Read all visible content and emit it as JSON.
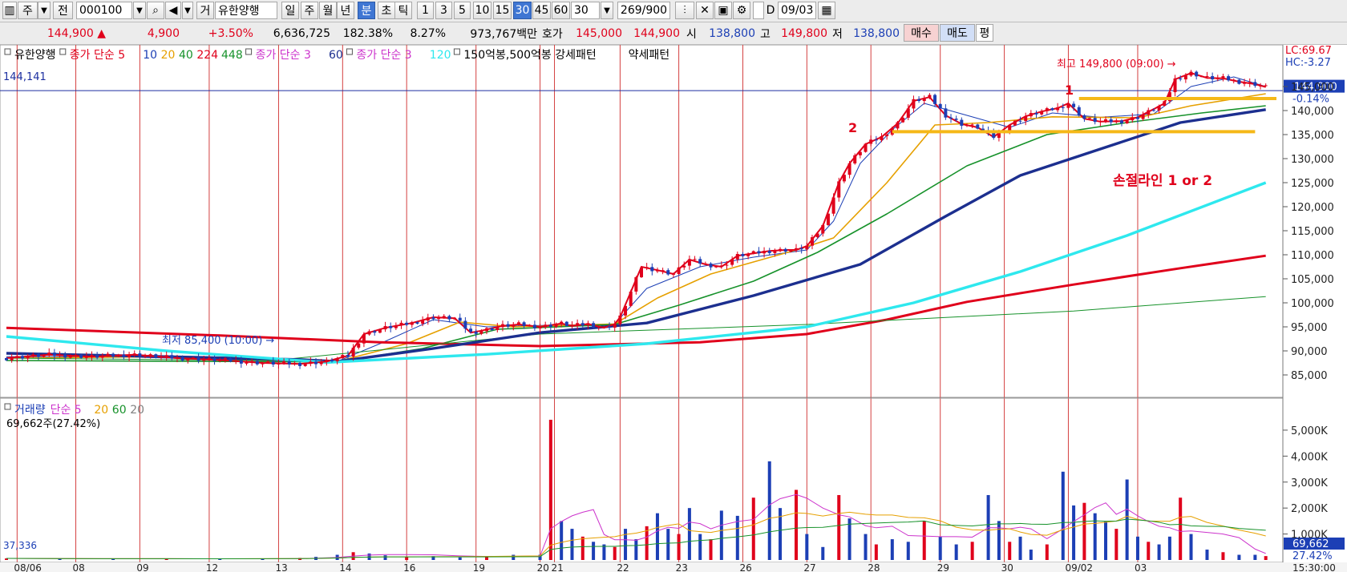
{
  "toolbar": {
    "mode": "주",
    "prev": "전",
    "code": "000100",
    "trade": "거",
    "stock_name": "유한양행",
    "periods": [
      "일",
      "주",
      "월",
      "년",
      "분",
      "초",
      "틱"
    ],
    "active_period": "분",
    "intervals": [
      "1",
      "3",
      "5",
      "10",
      "15",
      "30",
      "45",
      "60"
    ],
    "active_interval": "30",
    "interval_value": "30",
    "count": "269",
    "total": "/900",
    "checkbox_label": "D",
    "date": "09/03"
  },
  "quote": {
    "price": "144,900",
    "change": "4,900",
    "change_pct": "+3.50%",
    "volume": "6,636,725",
    "vol_ratio": "182.38%",
    "turnover": "8.27%",
    "amount": "973,767백만",
    "bid_label": "호가",
    "ask": "145,000",
    "bid": "144,900",
    "open_label": "시",
    "open": "138,800",
    "high_label": "고",
    "high": "149,800",
    "low_label": "저",
    "low": "138,800",
    "buy": "매수",
    "sell": "매도",
    "even": "평"
  },
  "legend_price": {
    "name": "유한양행",
    "ma1_label": "종가 단순 5",
    "ma1_periods": [
      {
        "label": "10",
        "color": "#1c3fb5"
      },
      {
        "label": "20",
        "color": "#e6a000"
      },
      {
        "label": "40",
        "color": "#17922b"
      },
      {
        "label": "224",
        "color": "#e0001b"
      },
      {
        "label": "448",
        "color": "#17922b"
      }
    ],
    "ma2_label": "종가 단순 3",
    "ma2_period": "60",
    "ma3_label": "종가 단순 3",
    "ma3_period": "120",
    "pattern": "150억봉,500억봉 강세패턴",
    "pattern2": "약세패턴"
  },
  "legend_volume": {
    "name": "거래량",
    "label": "단순 5",
    "periods": [
      {
        "label": "20",
        "color": "#e6a000"
      },
      {
        "label": "60",
        "color": "#17922b"
      },
      {
        "label": "20",
        "color": "#808080"
      }
    ],
    "value": "69,662주(27.42%)"
  },
  "chart_data": {
    "type": "line",
    "subtype": "candlestick-with-moving-averages",
    "x_tick_labels": [
      "08/06",
      "08",
      "09",
      "12",
      "13",
      "14",
      "16",
      "19",
      "20",
      "21",
      "22",
      "23",
      "26",
      "27",
      "28",
      "29",
      "30",
      "09/02",
      "03"
    ],
    "time_label": "15:30:00",
    "price_axis": {
      "ticks": [
        85000,
        90000,
        95000,
        100000,
        105000,
        110000,
        115000,
        120000,
        125000,
        130000,
        135000,
        140000,
        145000
      ],
      "ylim": [
        82000,
        152000
      ]
    },
    "volume_axis": {
      "ticks": [
        "1,000K",
        "2,000K",
        "3,000K",
        "4,000K",
        "5,000K"
      ],
      "ylim": [
        0,
        5800
      ]
    },
    "top_left_label": "144,141",
    "lc_label": "LC:69.67",
    "hc_label": "HC:-3.27",
    "price_badge": "144,900",
    "price_badge_pct": "-0.14%",
    "volume_badge": "69,662",
    "volume_badge_pct": "27.42%",
    "volume_axis_min_label": "37,336",
    "close_path": [
      [
        0,
        88500
      ],
      [
        8,
        89200
      ],
      [
        16,
        88800
      ],
      [
        24,
        89200
      ],
      [
        32,
        88500
      ],
      [
        40,
        88100
      ],
      [
        48,
        87500
      ],
      [
        55,
        87300
      ],
      [
        60,
        87800
      ],
      [
        64,
        89000
      ],
      [
        67,
        93500
      ],
      [
        71,
        94800
      ],
      [
        76,
        95800
      ],
      [
        80,
        97000
      ],
      [
        84,
        96800
      ],
      [
        87,
        93800
      ],
      [
        89,
        94200
      ],
      [
        93,
        95200
      ],
      [
        96,
        95500
      ],
      [
        100,
        95000
      ],
      [
        104,
        95700
      ],
      [
        106,
        95200
      ],
      [
        109,
        95600
      ],
      [
        112,
        94800
      ],
      [
        114,
        95600
      ],
      [
        115,
        97000
      ],
      [
        119,
        107500
      ],
      [
        122,
        106800
      ],
      [
        125,
        106000
      ],
      [
        128,
        109000
      ],
      [
        131,
        108000
      ],
      [
        134,
        107500
      ],
      [
        137,
        109800
      ],
      [
        140,
        110300
      ],
      [
        143,
        110800
      ],
      [
        146,
        111000
      ],
      [
        148,
        111000
      ],
      [
        150,
        111800
      ],
      [
        153,
        116000
      ],
      [
        156,
        125000
      ],
      [
        158,
        129000
      ],
      [
        161,
        133000
      ],
      [
        164,
        134500
      ],
      [
        167,
        137300
      ],
      [
        170,
        142000
      ],
      [
        173,
        142800
      ],
      [
        176,
        139000
      ],
      [
        179,
        137200
      ],
      [
        182,
        136500
      ],
      [
        185,
        134500
      ],
      [
        188,
        137000
      ],
      [
        191,
        138800
      ],
      [
        194,
        139800
      ],
      [
        197,
        140500
      ],
      [
        199,
        141500
      ],
      [
        202,
        138300
      ],
      [
        205,
        137700
      ],
      [
        209,
        137800
      ],
      [
        212,
        138600
      ],
      [
        215,
        140300
      ],
      [
        217,
        141500
      ],
      [
        219,
        146500
      ],
      [
        222,
        147800
      ],
      [
        225,
        146800
      ],
      [
        228,
        146700
      ],
      [
        231,
        146000
      ],
      [
        234,
        145500
      ],
      [
        236,
        144900
      ]
    ],
    "series": [
      {
        "name": "10",
        "color": "#1c3fb5",
        "width": 1,
        "values": [
          [
            0,
            88800
          ],
          [
            20,
            88800
          ],
          [
            50,
            88000
          ],
          [
            62,
            87800
          ],
          [
            70,
            91500
          ],
          [
            80,
            96500
          ],
          [
            90,
            95000
          ],
          [
            100,
            95300
          ],
          [
            114,
            95600
          ],
          [
            120,
            103000
          ],
          [
            130,
            107500
          ],
          [
            140,
            109500
          ],
          [
            150,
            111000
          ],
          [
            155,
            117000
          ],
          [
            160,
            129000
          ],
          [
            166,
            136000
          ],
          [
            172,
            141500
          ],
          [
            180,
            139000
          ],
          [
            188,
            136500
          ],
          [
            196,
            139500
          ],
          [
            205,
            138600
          ],
          [
            215,
            139300
          ],
          [
            222,
            145000
          ],
          [
            230,
            147000
          ],
          [
            236,
            145000
          ]
        ]
      },
      {
        "name": "20",
        "color": "#e6a000",
        "width": 1.6,
        "values": [
          [
            0,
            88500
          ],
          [
            30,
            88800
          ],
          [
            62,
            87800
          ],
          [
            75,
            91500
          ],
          [
            85,
            96000
          ],
          [
            95,
            95000
          ],
          [
            114,
            95600
          ],
          [
            122,
            101000
          ],
          [
            132,
            106000
          ],
          [
            148,
            111000
          ],
          [
            155,
            113500
          ],
          [
            165,
            125000
          ],
          [
            174,
            137000
          ],
          [
            184,
            137500
          ],
          [
            196,
            138700
          ],
          [
            212,
            138500
          ],
          [
            222,
            141000
          ],
          [
            236,
            143500
          ]
        ]
      },
      {
        "name": "40",
        "color": "#17922b",
        "width": 1.6,
        "values": [
          [
            0,
            88000
          ],
          [
            62,
            87700
          ],
          [
            78,
            90500
          ],
          [
            92,
            94500
          ],
          [
            114,
            95500
          ],
          [
            126,
            99500
          ],
          [
            140,
            104500
          ],
          [
            152,
            110500
          ],
          [
            165,
            118500
          ],
          [
            180,
            128500
          ],
          [
            195,
            135000
          ],
          [
            210,
            137500
          ],
          [
            224,
            139500
          ],
          [
            236,
            141000
          ]
        ]
      },
      {
        "name": "224",
        "color": "#e0001b",
        "width": 3,
        "values": [
          [
            0,
            94800
          ],
          [
            40,
            93200
          ],
          [
            70,
            91800
          ],
          [
            100,
            91000
          ],
          [
            130,
            91800
          ],
          [
            150,
            93500
          ],
          [
            165,
            96500
          ],
          [
            180,
            100200
          ],
          [
            200,
            103800
          ],
          [
            220,
            107200
          ],
          [
            236,
            109800
          ]
        ]
      },
      {
        "name": "448",
        "color": "#17922b",
        "width": 1,
        "values": [
          [
            0,
            88500
          ],
          [
            50,
            88000
          ],
          [
            100,
            93500
          ],
          [
            150,
            95500
          ],
          [
            200,
            98300
          ],
          [
            236,
            101300
          ]
        ]
      },
      {
        "name": "60",
        "color": "#1c2f8f",
        "width": 3.4,
        "values": [
          [
            0,
            89500
          ],
          [
            30,
            88800
          ],
          [
            55,
            88200
          ],
          [
            62,
            87800
          ],
          [
            80,
            90500
          ],
          [
            100,
            93800
          ],
          [
            120,
            95800
          ],
          [
            140,
            101500
          ],
          [
            160,
            108000
          ],
          [
            176,
            118000
          ],
          [
            190,
            126500
          ],
          [
            205,
            132000
          ],
          [
            220,
            137500
          ],
          [
            236,
            140200
          ]
        ]
      },
      {
        "name": "120",
        "color": "#2ee8ee",
        "width": 3.4,
        "values": [
          [
            0,
            93000
          ],
          [
            30,
            90000
          ],
          [
            60,
            87600
          ],
          [
            90,
            89300
          ],
          [
            120,
            91500
          ],
          [
            150,
            95000
          ],
          [
            170,
            100000
          ],
          [
            190,
            106500
          ],
          [
            210,
            114000
          ],
          [
            236,
            125000
          ]
        ]
      }
    ],
    "volume_bars": [
      [
        0,
        60
      ],
      [
        10,
        50
      ],
      [
        20,
        40
      ],
      [
        30,
        50
      ],
      [
        40,
        30
      ],
      [
        48,
        60
      ],
      [
        55,
        80
      ],
      [
        58,
        120
      ],
      [
        62,
        200
      ],
      [
        65,
        300
      ],
      [
        68,
        250
      ],
      [
        71,
        180
      ],
      [
        75,
        120
      ],
      [
        80,
        150
      ],
      [
        85,
        100
      ],
      [
        90,
        120
      ],
      [
        95,
        200
      ],
      [
        100,
        200
      ],
      [
        102,
        5400
      ],
      [
        104,
        1500
      ],
      [
        106,
        1200
      ],
      [
        108,
        900
      ],
      [
        110,
        700
      ],
      [
        112,
        600
      ],
      [
        114,
        500
      ],
      [
        116,
        1200
      ],
      [
        118,
        800
      ],
      [
        120,
        1300
      ],
      [
        122,
        1800
      ],
      [
        124,
        1200
      ],
      [
        126,
        1000
      ],
      [
        128,
        2000
      ],
      [
        130,
        1000
      ],
      [
        132,
        800
      ],
      [
        134,
        1900
      ],
      [
        137,
        1700
      ],
      [
        140,
        2400
      ],
      [
        143,
        3800
      ],
      [
        145,
        2000
      ],
      [
        148,
        2700
      ],
      [
        150,
        1000
      ],
      [
        153,
        500
      ],
      [
        156,
        2500
      ],
      [
        158,
        1600
      ],
      [
        161,
        1000
      ],
      [
        163,
        600
      ],
      [
        166,
        800
      ],
      [
        169,
        700
      ],
      [
        172,
        1500
      ],
      [
        175,
        900
      ],
      [
        178,
        600
      ],
      [
        181,
        700
      ],
      [
        184,
        2500
      ],
      [
        186,
        1500
      ],
      [
        188,
        700
      ],
      [
        190,
        900
      ],
      [
        192,
        400
      ],
      [
        195,
        600
      ],
      [
        198,
        3400
      ],
      [
        200,
        2100
      ],
      [
        202,
        2200
      ],
      [
        204,
        1800
      ],
      [
        206,
        1500
      ],
      [
        208,
        1200
      ],
      [
        210,
        3100
      ],
      [
        212,
        900
      ],
      [
        214,
        700
      ],
      [
        216,
        600
      ],
      [
        218,
        900
      ],
      [
        220,
        2400
      ],
      [
        222,
        1000
      ],
      [
        225,
        400
      ],
      [
        228,
        300
      ],
      [
        231,
        200
      ],
      [
        234,
        200
      ],
      [
        236,
        150
      ]
    ],
    "annotations": {
      "max_label": "최고 149,800 (09:00)",
      "min_label": "최저 85,400 (10:00)",
      "line1_label": "1",
      "line2_label": "2",
      "stop_label": "손절라인 1 or 2",
      "line1": {
        "x": [
          201,
          238
        ],
        "y": 142500
      },
      "line2": {
        "x": [
          166,
          234
        ],
        "y": 135600
      }
    }
  }
}
